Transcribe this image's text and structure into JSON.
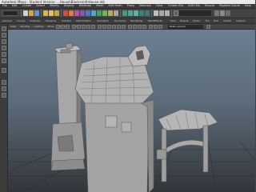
{
  "window": {
    "title": "Autodesk Maya - Student Version: ...House\\BlacksmithHouse.mb",
    "title_bg": "#e9e9e9"
  },
  "menu": {
    "items": [
      "File",
      "Edit",
      "Create",
      "Select",
      "Modify",
      "Display",
      "Windows",
      "Mesh",
      "Edit Mesh",
      "Proxy",
      "Normals",
      "Color",
      "Create UVs",
      "Edit UVs",
      "Muscle",
      "Pipeline Cache",
      "Help"
    ]
  },
  "shelf": {
    "mode": "Polygons"
  },
  "shelf_tabs": [
    "General",
    "Curves",
    "Surfaces",
    "Polygons",
    "Subdivs",
    "Deformation",
    "Animation",
    "Dynamics",
    "Rendering",
    "PaintEffects",
    "Toon",
    "Muscle",
    "Fluids",
    "Fur",
    "Hair",
    "nCloth",
    "Custom"
  ],
  "panel": {
    "menus": [
      "View",
      "Shading",
      "Lighting",
      "Show",
      "Renderer",
      "Panels"
    ],
    "camera_field": "Multi-camera"
  },
  "viewport": {
    "background_top": "#6c7f91",
    "background_bottom": "#33363a",
    "model_color": "#9b9b9b",
    "grid_color": "#2a2d30"
  }
}
